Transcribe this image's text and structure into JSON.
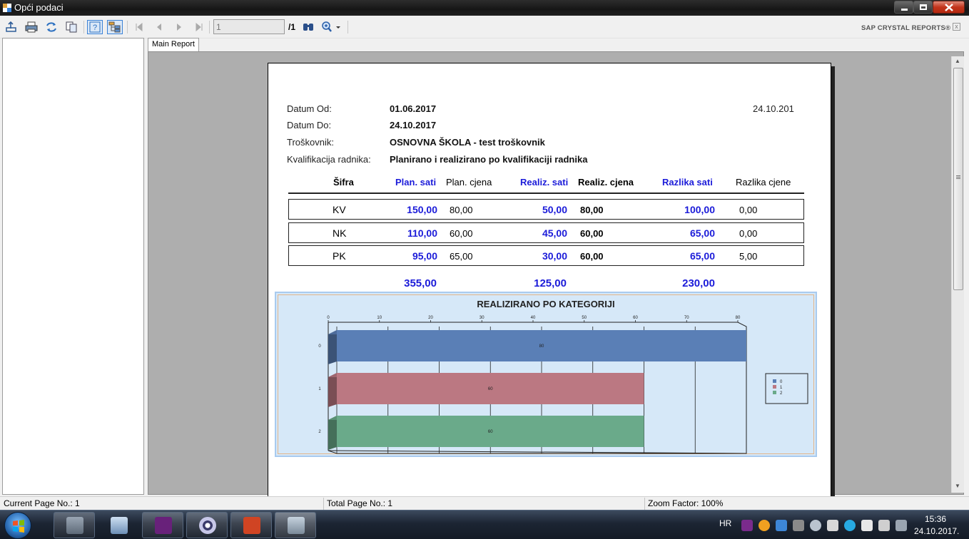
{
  "window": {
    "title": "Opći podaci"
  },
  "toolbar": {
    "page_input_value": "1",
    "page_total": "/1",
    "brand": "SAP CRYSTAL REPORTS®",
    "brand_close": "x",
    "icons": [
      "export-icon",
      "print-icon",
      "refresh-icon",
      "copy-icon",
      "help-icon",
      "group-tree-icon",
      "first-page-icon",
      "prev-page-icon",
      "next-page-icon",
      "last-page-icon",
      "find-icon",
      "zoom-icon"
    ]
  },
  "tabs": [
    "Main Report"
  ],
  "report": {
    "header": {
      "datum_od_label": "Datum Od:",
      "datum_od_value": "01.06.2017",
      "datum_do_label": "Datum Do:",
      "datum_do_value": "24.10.2017",
      "troskovnik_label": "Troškovnik:",
      "troskovnik_value": "OSNOVNA ŠKOLA - test troškovnik",
      "kvalifikacija_label": "Kvalifikacija radnika:",
      "kvalifikacija_value": "Planirano i realizirano po kvalifikaciji radnika",
      "print_date": "24.10.201"
    },
    "columns": [
      "Šifra",
      "Plan. sati",
      "Plan. cjena",
      "Realiz. sati",
      "Realiz. cjena",
      "Razlika sati",
      "Razlika cjene"
    ],
    "rows": [
      [
        "KV",
        "150,00",
        "80,00",
        "50,00",
        "80,00",
        "100,00",
        "0,00"
      ],
      [
        "NK",
        "110,00",
        "60,00",
        "45,00",
        "60,00",
        "65,00",
        "0,00"
      ],
      [
        "PK",
        "95,00",
        "65,00",
        "30,00",
        "60,00",
        "65,00",
        "5,00"
      ]
    ],
    "totals": {
      "plan_sati": "355,00",
      "realiz_sati": "125,00",
      "razlika_sati": "230,00"
    }
  },
  "chart_data": {
    "type": "bar",
    "orientation": "horizontal",
    "title": "REALIZIRANO PO KATEGORIJI",
    "categories": [
      "0",
      "1",
      "2"
    ],
    "series": [
      {
        "name": "0",
        "values": [
          80,
          null,
          null
        ],
        "color": "#5a7fb6"
      },
      {
        "name": "1",
        "values": [
          null,
          60,
          null
        ],
        "color": "#bb7882"
      },
      {
        "name": "2",
        "values": [
          null,
          null,
          60
        ],
        "color": "#6aaa8a"
      }
    ],
    "data_labels": [
      "80",
      "60",
      "60"
    ],
    "xlim": [
      0,
      80
    ],
    "xticks": [
      "0",
      "10",
      "20",
      "30",
      "40",
      "50",
      "60",
      "70",
      "80"
    ],
    "grid": true,
    "legend": [
      "0",
      "1",
      "2"
    ],
    "legend_position": "right"
  },
  "statusbar": {
    "current_page": "Current Page No.: 1",
    "total_pages": "Total Page No.: 1",
    "zoom": "Zoom Factor: 100%"
  },
  "taskbar": {
    "language": "HR",
    "time": "15:36",
    "date": "24.10.2017."
  }
}
